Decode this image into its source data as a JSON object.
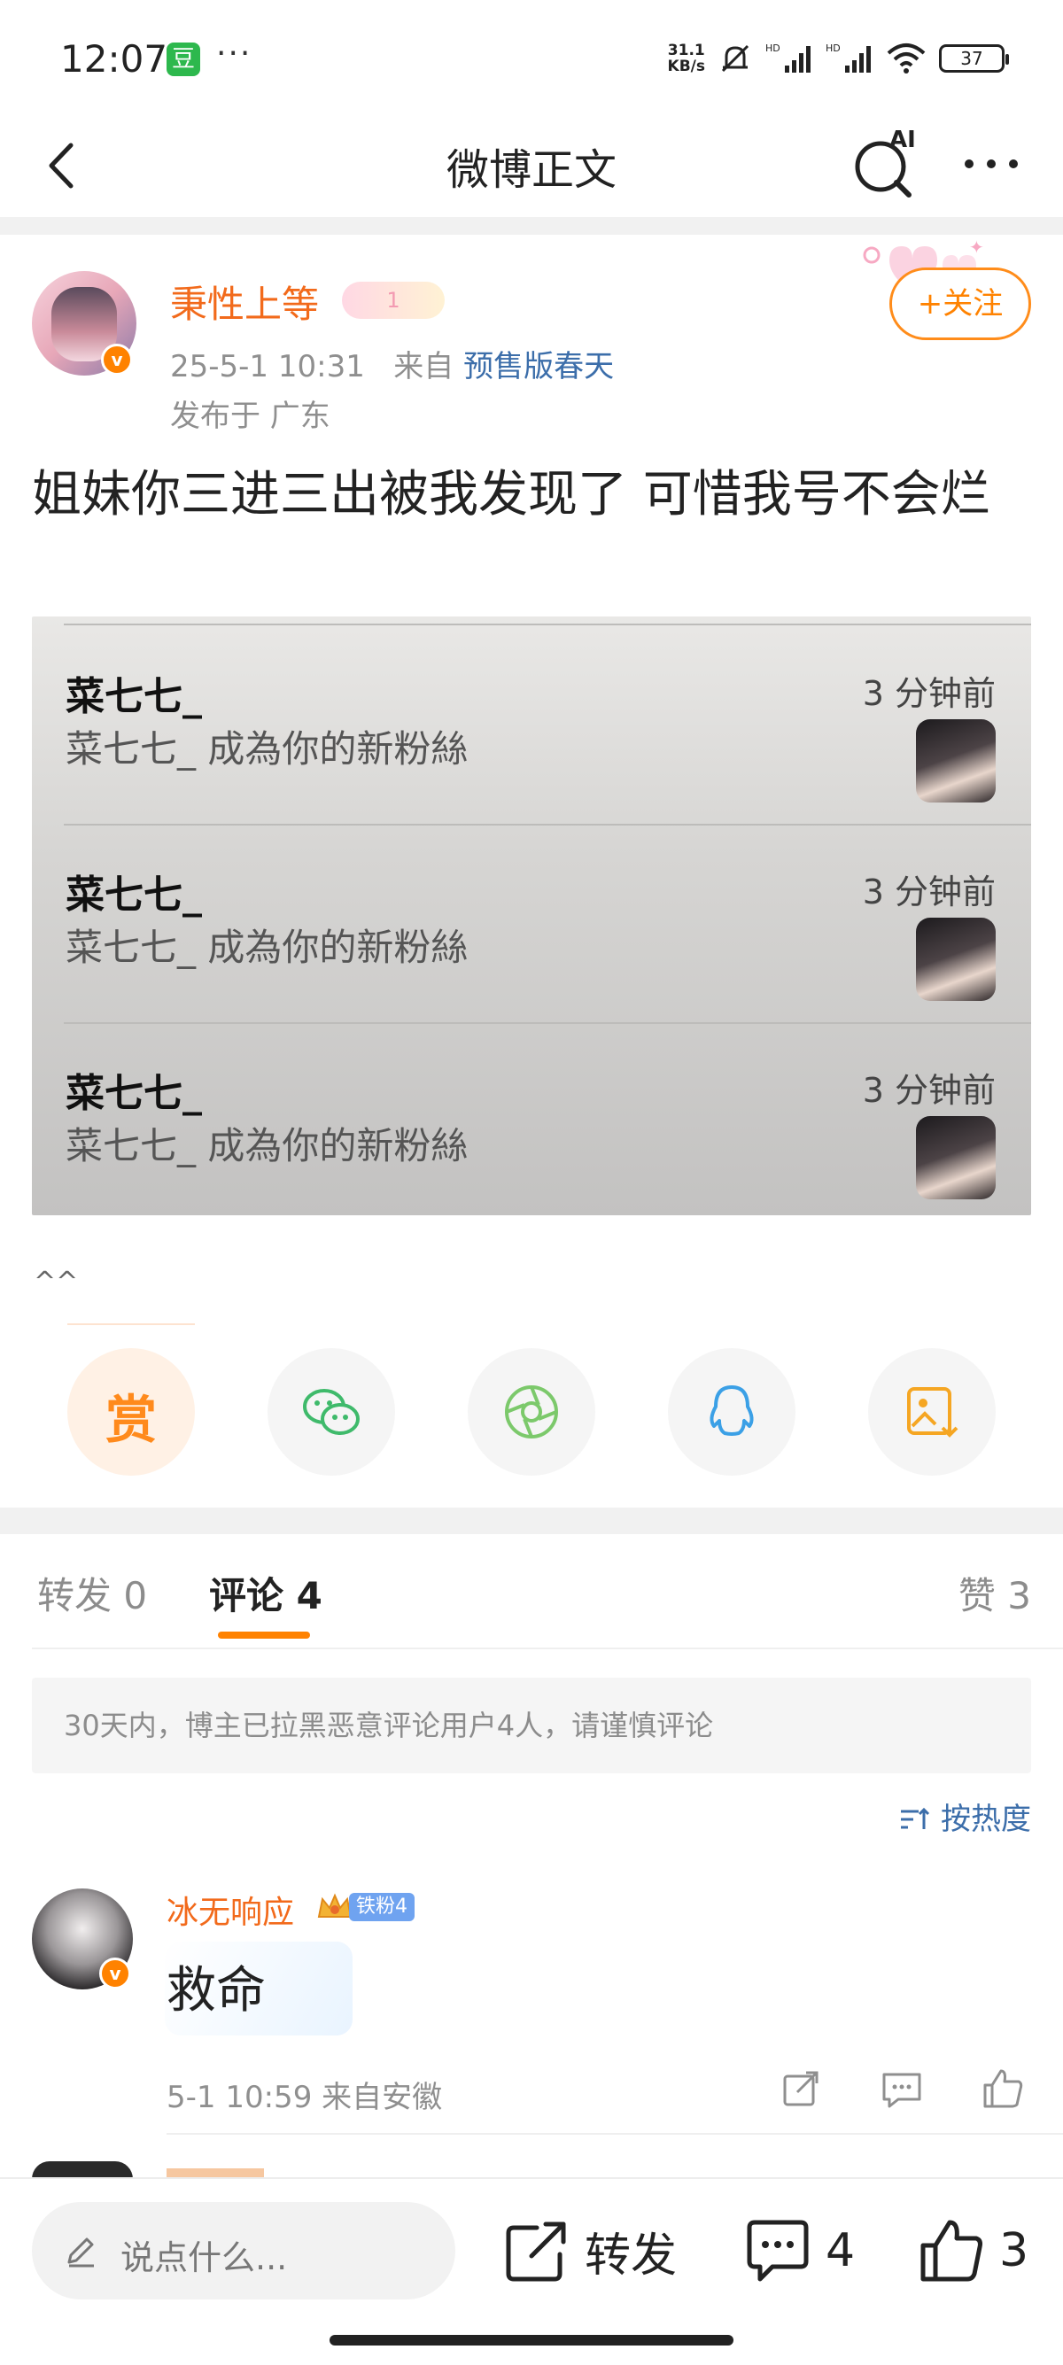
{
  "status_bar": {
    "time": "12:07",
    "app_badge": "豆",
    "dots": "···",
    "net_speed_top": "31.1",
    "net_speed_bottom": "KB/s",
    "battery": "37"
  },
  "navbar": {
    "title": "微博正文",
    "ai_label": "AI"
  },
  "post": {
    "author": "秉性上等",
    "vip_badge": "1",
    "date": "25-5-1 10:31",
    "from_prefix": "来自",
    "source": "预售版春天",
    "location": "发布于 广东",
    "follow_label": "+关注",
    "text": "姐妹你三进三出被我发现了 可惜我号不会烂",
    "image_notifications": [
      {
        "name": "菜七七_",
        "desc": "菜七七_ 成為你的新粉絲",
        "time": "3 分钟前"
      },
      {
        "name": "菜七七_",
        "desc": "菜七七_ 成為你的新粉絲",
        "time": "3 分钟前"
      },
      {
        "name": "菜七七_",
        "desc": "菜七七_ 成為你的新粉絲",
        "time": "3 分钟前"
      }
    ],
    "caret": "^^"
  },
  "share": {
    "reward_label": "赏",
    "buttons": [
      "reward",
      "wechat-icon",
      "moments-icon",
      "qq-icon",
      "save-image-icon"
    ]
  },
  "tabs": {
    "repost_label": "转发",
    "repost_count": "0",
    "comment_label": "评论",
    "comment_count": "4",
    "like_label": "赞",
    "like_count": "3"
  },
  "notice": "30天内，博主已拉黑恶意评论用户4人，请谨慎评论",
  "sort_label": "按热度",
  "comments": [
    {
      "name": "冰无响应",
      "fan_badge": "铁粉4",
      "text": "救命",
      "meta": "5-1 10:59 来自安徽"
    }
  ],
  "bottom_bar": {
    "placeholder": "说点什么...",
    "repost_label": "转发",
    "comment_count": "4",
    "like_count": "3"
  },
  "colors": {
    "accent_orange": "#ff8200",
    "name_orange": "#f26a1b",
    "link_blue": "#3c6eaa",
    "gray_text": "#8f8f8f"
  }
}
